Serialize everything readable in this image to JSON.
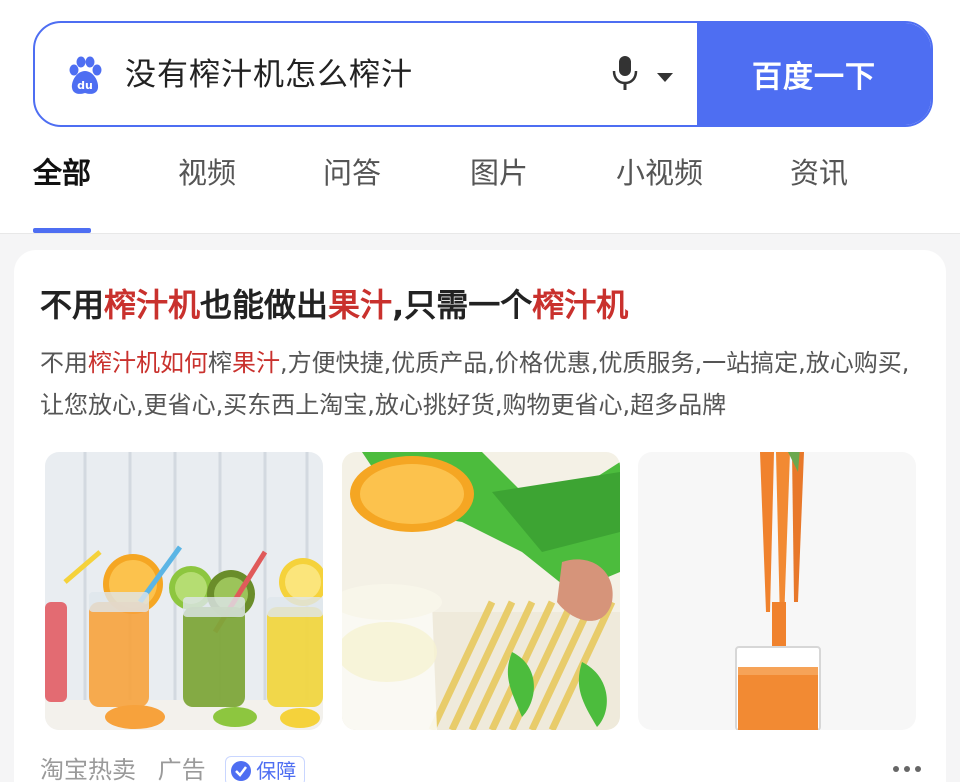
{
  "search": {
    "query": "没有榨汁机怎么榨汁",
    "button_label": "百度一下",
    "logo_text": "du",
    "accent_color": "#4e6ef2"
  },
  "tabs": [
    {
      "label": "全部",
      "active": true
    },
    {
      "label": "视频",
      "active": false
    },
    {
      "label": "问答",
      "active": false
    },
    {
      "label": "图片",
      "active": false
    },
    {
      "label": "小视频",
      "active": false
    },
    {
      "label": "资讯",
      "active": false
    }
  ],
  "ad": {
    "title_parts": [
      "不用",
      "榨汁机",
      "也能做出",
      "果汁",
      ",只需一个",
      "榨汁机"
    ],
    "desc_parts": [
      "不用",
      "榨汁机如何",
      "榨",
      "果汁",
      ",方便快捷,优质产品,价格优惠,优质服务,一站搞定,放心购买,让您放心,更省心,买东西上淘宝,放心挑好货,购物更省心,超多品牌"
    ],
    "highlight_color": "#c9312d",
    "images": [
      {
        "icon": "juice-bottles-image"
      },
      {
        "icon": "citrus-squeezer-image"
      },
      {
        "icon": "carrot-juice-image"
      }
    ],
    "source": "淘宝热卖",
    "ad_label": "广告",
    "badge_label": "保障"
  }
}
